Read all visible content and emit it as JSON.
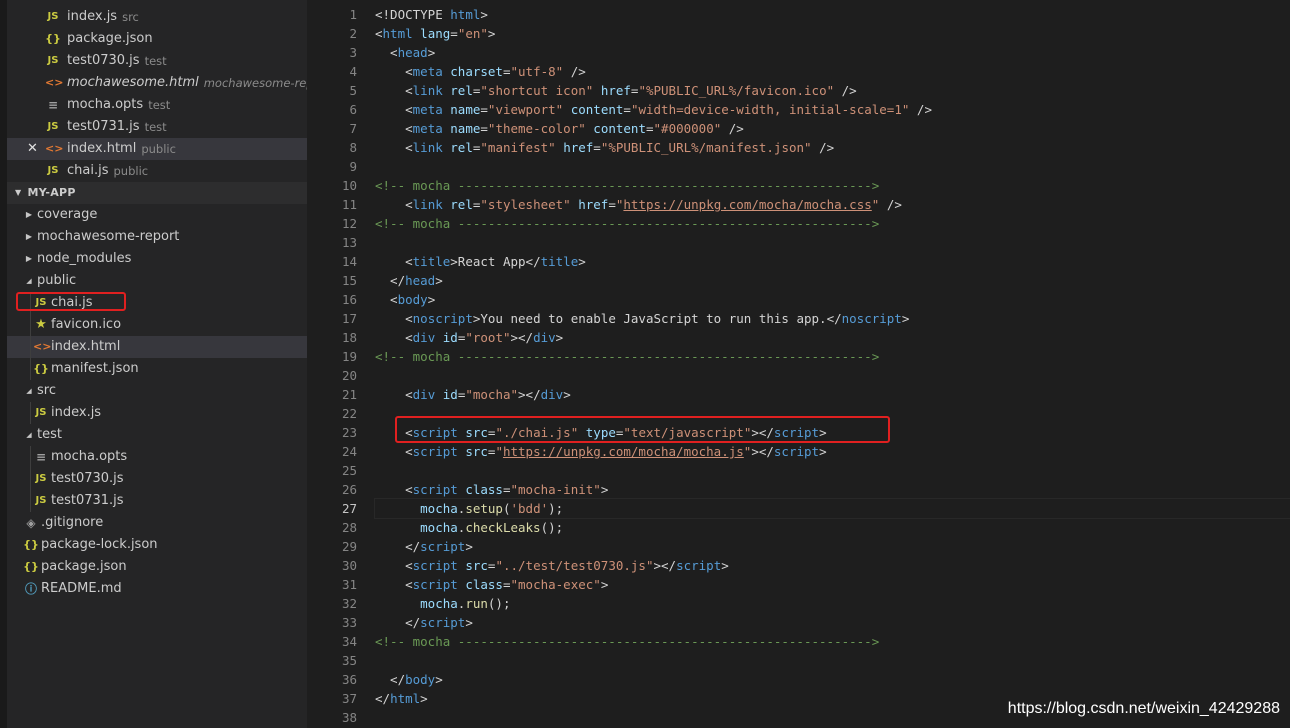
{
  "sidebar": {
    "open_editors": [
      {
        "icon": "JS",
        "type": "js",
        "name": "index.js",
        "desc": "src"
      },
      {
        "icon": "{}",
        "type": "json",
        "name": "package.json",
        "desc": ""
      },
      {
        "icon": "JS",
        "type": "js",
        "name": "test0730.js",
        "desc": "test"
      },
      {
        "icon": "<>",
        "type": "html",
        "name": "mochawesome.html",
        "desc": "mochawesome-report",
        "italic": true
      },
      {
        "icon": "≡",
        "type": "opts",
        "name": "mocha.opts",
        "desc": "test"
      },
      {
        "icon": "JS",
        "type": "js",
        "name": "test0731.js",
        "desc": "test"
      },
      {
        "icon": "<>",
        "type": "html",
        "name": "index.html",
        "desc": "public",
        "active": true,
        "close": "✕"
      },
      {
        "icon": "JS",
        "type": "js",
        "name": "chai.js",
        "desc": "public"
      }
    ],
    "project_title": "MY-APP",
    "tree": [
      {
        "depth": 0,
        "folder": true,
        "open": false,
        "name": "coverage"
      },
      {
        "depth": 0,
        "folder": true,
        "open": false,
        "name": "mochawesome-report"
      },
      {
        "depth": 0,
        "folder": true,
        "open": false,
        "name": "node_modules"
      },
      {
        "depth": 0,
        "folder": true,
        "open": true,
        "name": "public"
      },
      {
        "depth": 1,
        "icon": "JS",
        "type": "js",
        "name": "chai.js"
      },
      {
        "depth": 1,
        "icon": "★",
        "type": "star",
        "name": "favicon.ico"
      },
      {
        "depth": 1,
        "icon": "<>",
        "type": "html",
        "name": "index.html",
        "active": true
      },
      {
        "depth": 1,
        "icon": "{}",
        "type": "json",
        "name": "manifest.json"
      },
      {
        "depth": 0,
        "folder": true,
        "open": true,
        "name": "src"
      },
      {
        "depth": 1,
        "icon": "JS",
        "type": "js",
        "name": "index.js"
      },
      {
        "depth": 0,
        "folder": true,
        "open": true,
        "name": "test"
      },
      {
        "depth": 1,
        "icon": "≡",
        "type": "opts",
        "name": "mocha.opts"
      },
      {
        "depth": 1,
        "icon": "JS",
        "type": "js",
        "name": "test0730.js"
      },
      {
        "depth": 1,
        "icon": "JS",
        "type": "js",
        "name": "test0731.js"
      },
      {
        "depth": 0,
        "icon": "◈",
        "type": "git",
        "name": ".gitignore"
      },
      {
        "depth": 0,
        "icon": "{}",
        "type": "json",
        "name": "package-lock.json"
      },
      {
        "depth": 0,
        "icon": "{}",
        "type": "json",
        "name": "package.json"
      },
      {
        "depth": 0,
        "icon": "ⓘ",
        "type": "info",
        "name": "README.md"
      }
    ]
  },
  "editor": {
    "current_line": 27,
    "lines": [
      [
        [
          "t",
          "<!DOCTYPE "
        ],
        [
          "tag",
          "html"
        ],
        [
          "t",
          ">"
        ]
      ],
      [
        [
          "t",
          "<"
        ],
        [
          "tag",
          "html"
        ],
        [
          "t",
          " "
        ],
        [
          "attr",
          "lang"
        ],
        [
          "t",
          "="
        ],
        [
          "str",
          "\"en\""
        ],
        [
          "t",
          ">"
        ]
      ],
      [
        [
          "t",
          "  <"
        ],
        [
          "tag",
          "head"
        ],
        [
          "t",
          ">"
        ]
      ],
      [
        [
          "t",
          "    <"
        ],
        [
          "tag",
          "meta"
        ],
        [
          "t",
          " "
        ],
        [
          "attr",
          "charset"
        ],
        [
          "t",
          "="
        ],
        [
          "str",
          "\"utf-8\""
        ],
        [
          "t",
          " />"
        ]
      ],
      [
        [
          "t",
          "    <"
        ],
        [
          "tag",
          "link"
        ],
        [
          "t",
          " "
        ],
        [
          "attr",
          "rel"
        ],
        [
          "t",
          "="
        ],
        [
          "str",
          "\"shortcut icon\""
        ],
        [
          "t",
          " "
        ],
        [
          "attr",
          "href"
        ],
        [
          "t",
          "="
        ],
        [
          "str",
          "\"%PUBLIC_URL%/favicon.ico\""
        ],
        [
          "t",
          " />"
        ]
      ],
      [
        [
          "t",
          "    <"
        ],
        [
          "tag",
          "meta"
        ],
        [
          "t",
          " "
        ],
        [
          "attr",
          "name"
        ],
        [
          "t",
          "="
        ],
        [
          "str",
          "\"viewport\""
        ],
        [
          "t",
          " "
        ],
        [
          "attr",
          "content"
        ],
        [
          "t",
          "="
        ],
        [
          "str",
          "\"width=device-width, initial-scale=1\""
        ],
        [
          "t",
          " />"
        ]
      ],
      [
        [
          "t",
          "    <"
        ],
        [
          "tag",
          "meta"
        ],
        [
          "t",
          " "
        ],
        [
          "attr",
          "name"
        ],
        [
          "t",
          "="
        ],
        [
          "str",
          "\"theme-color\""
        ],
        [
          "t",
          " "
        ],
        [
          "attr",
          "content"
        ],
        [
          "t",
          "="
        ],
        [
          "str",
          "\"#000000\""
        ],
        [
          "t",
          " />"
        ]
      ],
      [
        [
          "t",
          "    <"
        ],
        [
          "tag",
          "link"
        ],
        [
          "t",
          " "
        ],
        [
          "attr",
          "rel"
        ],
        [
          "t",
          "="
        ],
        [
          "str",
          "\"manifest\""
        ],
        [
          "t",
          " "
        ],
        [
          "attr",
          "href"
        ],
        [
          "t",
          "="
        ],
        [
          "str",
          "\"%PUBLIC_URL%/manifest.json\""
        ],
        [
          "t",
          " />"
        ]
      ],
      [
        [
          "t",
          ""
        ]
      ],
      [
        [
          "cmt",
          "<!-- mocha ------------------------------------------------------->"
        ]
      ],
      [
        [
          "t",
          "    <"
        ],
        [
          "tag",
          "link"
        ],
        [
          "t",
          " "
        ],
        [
          "attr",
          "rel"
        ],
        [
          "t",
          "="
        ],
        [
          "str",
          "\"stylesheet\""
        ],
        [
          "t",
          " "
        ],
        [
          "attr",
          "href"
        ],
        [
          "t",
          "="
        ],
        [
          "str",
          "\""
        ],
        [
          "strlink",
          "https://unpkg.com/mocha/mocha.css"
        ],
        [
          "str",
          "\""
        ],
        [
          "t",
          " />"
        ]
      ],
      [
        [
          "cmt",
          "<!-- mocha ------------------------------------------------------->"
        ]
      ],
      [
        [
          "t",
          ""
        ]
      ],
      [
        [
          "t",
          "    <"
        ],
        [
          "tag",
          "title"
        ],
        [
          "t",
          ">React App</"
        ],
        [
          "tag",
          "title"
        ],
        [
          "t",
          ">"
        ]
      ],
      [
        [
          "t",
          "  </"
        ],
        [
          "tag",
          "head"
        ],
        [
          "t",
          ">"
        ]
      ],
      [
        [
          "t",
          "  <"
        ],
        [
          "tag",
          "body"
        ],
        [
          "t",
          ">"
        ]
      ],
      [
        [
          "t",
          "    <"
        ],
        [
          "tag",
          "noscript"
        ],
        [
          "t",
          ">You need to enable JavaScript to run this app.</"
        ],
        [
          "tag",
          "noscript"
        ],
        [
          "t",
          ">"
        ]
      ],
      [
        [
          "t",
          "    <"
        ],
        [
          "tag",
          "div"
        ],
        [
          "t",
          " "
        ],
        [
          "attr",
          "id"
        ],
        [
          "t",
          "="
        ],
        [
          "str",
          "\"root\""
        ],
        [
          "t",
          "></"
        ],
        [
          "tag",
          "div"
        ],
        [
          "t",
          ">"
        ]
      ],
      [
        [
          "cmt",
          "<!-- mocha ------------------------------------------------------->"
        ]
      ],
      [
        [
          "t",
          ""
        ]
      ],
      [
        [
          "t",
          "    <"
        ],
        [
          "tag",
          "div"
        ],
        [
          "t",
          " "
        ],
        [
          "attr",
          "id"
        ],
        [
          "t",
          "="
        ],
        [
          "str",
          "\"mocha\""
        ],
        [
          "t",
          "></"
        ],
        [
          "tag",
          "div"
        ],
        [
          "t",
          ">"
        ]
      ],
      [
        [
          "t",
          ""
        ]
      ],
      [
        [
          "t",
          "    <"
        ],
        [
          "tag",
          "script"
        ],
        [
          "t",
          " "
        ],
        [
          "attr",
          "src"
        ],
        [
          "t",
          "="
        ],
        [
          "str",
          "\"./chai.js\""
        ],
        [
          "t",
          " "
        ],
        [
          "attr",
          "type"
        ],
        [
          "t",
          "="
        ],
        [
          "str",
          "\"text/javascript\""
        ],
        [
          "t",
          "></"
        ],
        [
          "tag",
          "script"
        ],
        [
          "t",
          ">"
        ]
      ],
      [
        [
          "t",
          "    <"
        ],
        [
          "tag",
          "script"
        ],
        [
          "t",
          " "
        ],
        [
          "attr",
          "src"
        ],
        [
          "t",
          "="
        ],
        [
          "str",
          "\""
        ],
        [
          "strlink",
          "https://unpkg.com/mocha/mocha.js"
        ],
        [
          "str",
          "\""
        ],
        [
          "t",
          "></"
        ],
        [
          "tag",
          "script"
        ],
        [
          "t",
          ">"
        ]
      ],
      [
        [
          "t",
          ""
        ]
      ],
      [
        [
          "t",
          "    <"
        ],
        [
          "tag",
          "script"
        ],
        [
          "t",
          " "
        ],
        [
          "attr",
          "class"
        ],
        [
          "t",
          "="
        ],
        [
          "str",
          "\"mocha-init\""
        ],
        [
          "t",
          ">"
        ]
      ],
      [
        [
          "t",
          "      "
        ],
        [
          "var",
          "mocha"
        ],
        [
          "t",
          "."
        ],
        [
          "fn",
          "setup"
        ],
        [
          "t",
          "("
        ],
        [
          "str",
          "'bdd'"
        ],
        [
          "t",
          ");"
        ]
      ],
      [
        [
          "t",
          "      "
        ],
        [
          "var",
          "mocha"
        ],
        [
          "t",
          "."
        ],
        [
          "fn",
          "checkLeaks"
        ],
        [
          "t",
          "();"
        ]
      ],
      [
        [
          "t",
          "    </"
        ],
        [
          "tag",
          "script"
        ],
        [
          "t",
          ">"
        ]
      ],
      [
        [
          "t",
          "    <"
        ],
        [
          "tag",
          "script"
        ],
        [
          "t",
          " "
        ],
        [
          "attr",
          "src"
        ],
        [
          "t",
          "="
        ],
        [
          "str",
          "\"../test/test0730.js\""
        ],
        [
          "t",
          "></"
        ],
        [
          "tag",
          "script"
        ],
        [
          "t",
          ">"
        ]
      ],
      [
        [
          "t",
          "    <"
        ],
        [
          "tag",
          "script"
        ],
        [
          "t",
          " "
        ],
        [
          "attr",
          "class"
        ],
        [
          "t",
          "="
        ],
        [
          "str",
          "\"mocha-exec\""
        ],
        [
          "t",
          ">"
        ]
      ],
      [
        [
          "t",
          "      "
        ],
        [
          "var",
          "mocha"
        ],
        [
          "t",
          "."
        ],
        [
          "fn",
          "run"
        ],
        [
          "t",
          "();"
        ]
      ],
      [
        [
          "t",
          "    </"
        ],
        [
          "tag",
          "script"
        ],
        [
          "t",
          ">"
        ]
      ],
      [
        [
          "cmt",
          "<!-- mocha ------------------------------------------------------->"
        ]
      ],
      [
        [
          "t",
          ""
        ]
      ],
      [
        [
          "t",
          "  </"
        ],
        [
          "tag",
          "body"
        ],
        [
          "t",
          ">"
        ]
      ],
      [
        [
          "t",
          "</"
        ],
        [
          "tag",
          "html"
        ],
        [
          "t",
          ">"
        ]
      ],
      [
        [
          "t",
          ""
        ]
      ]
    ]
  },
  "watermark": "https://blog.csdn.net/weixin_42429288"
}
